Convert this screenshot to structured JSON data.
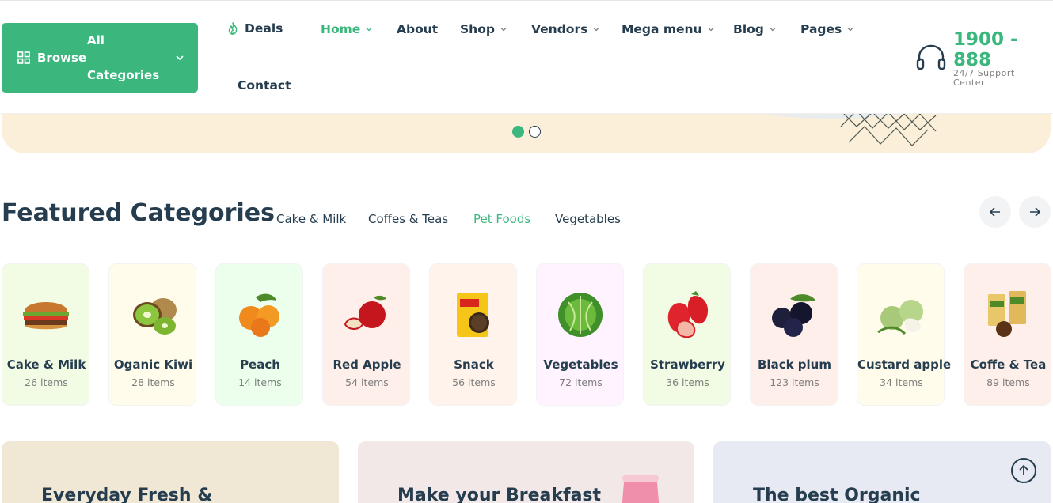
{
  "header": {
    "browse": {
      "line1": "All",
      "line2": "Browse",
      "line3": "Categories"
    },
    "nav": [
      {
        "label": "Deals"
      },
      {
        "label": "Home"
      },
      {
        "label": "About"
      },
      {
        "label": "Shop"
      },
      {
        "label": "Vendors"
      },
      {
        "label": "Mega menu"
      },
      {
        "label": "Blog"
      },
      {
        "label": "Pages"
      },
      {
        "label": "Contact"
      }
    ],
    "support": {
      "number": "1900 - 888",
      "label": "24/7 Support Center"
    }
  },
  "featured": {
    "title": "Featured Categories",
    "tabs": [
      "Cake & Milk",
      "Coffes & Teas",
      "Pet Foods",
      "Vegetables"
    ],
    "active_tab": "Pet Foods",
    "categories": [
      {
        "name": "Cake & Milk",
        "count": "26 items",
        "bg": "#f2fce4"
      },
      {
        "name": "Oganic Kiwi",
        "count": "28 items",
        "bg": "#fffceb"
      },
      {
        "name": "Peach",
        "count": "14 items",
        "bg": "#ecffec"
      },
      {
        "name": "Red Apple",
        "count": "54 items",
        "bg": "#feefea"
      },
      {
        "name": "Snack",
        "count": "56 items",
        "bg": "#fff3eb"
      },
      {
        "name": "Vegetables",
        "count": "72 items",
        "bg": "#fff3ff"
      },
      {
        "name": "Strawberry",
        "count": "36 items",
        "bg": "#f2fce4"
      },
      {
        "name": "Black plum",
        "count": "123 items",
        "bg": "#feefea"
      },
      {
        "name": "Custard apple",
        "count": "34 items",
        "bg": "#fffceb"
      },
      {
        "name": "Coffe & Tea",
        "count": "89 items",
        "bg": "#feefea"
      }
    ]
  },
  "promos": [
    {
      "text": "Everyday Fresh &",
      "bg": "#f0e8d5"
    },
    {
      "text": "Make your Breakfast",
      "bg": "#f3e8e8"
    },
    {
      "text": "The best Organic",
      "bg": "#e7eaf3"
    }
  ],
  "colors": {
    "brand": "#3bb77e",
    "heading": "#253d4e",
    "muted": "#7e7e7e"
  }
}
